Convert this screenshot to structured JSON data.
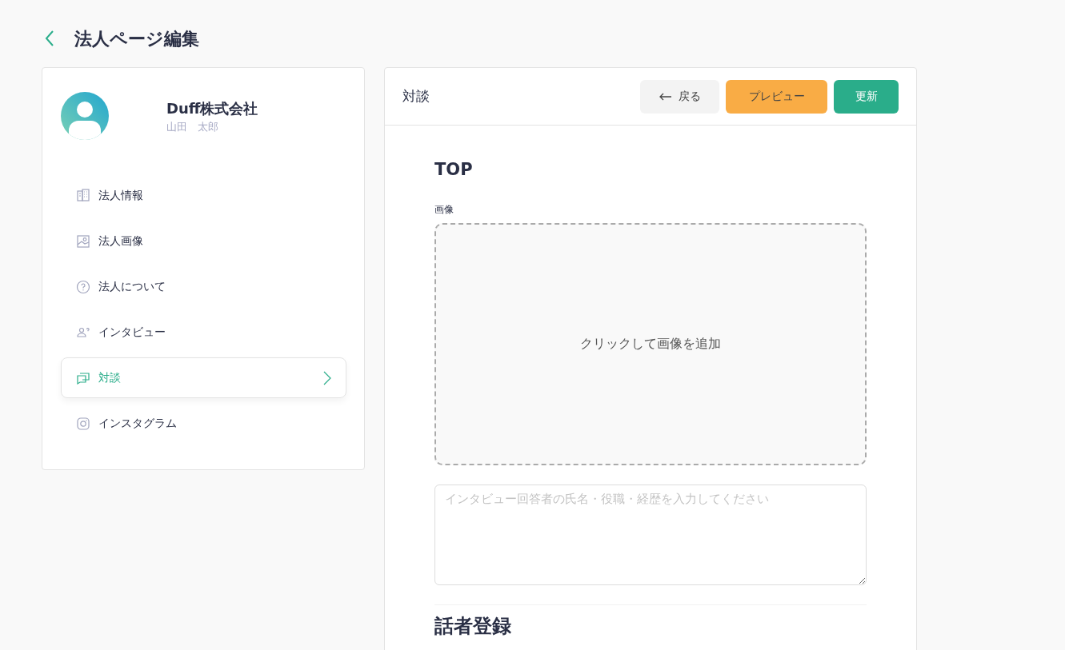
{
  "page_title": "法人ページ編集",
  "profile": {
    "company": "Duff株式会社",
    "person": "山田　太郎"
  },
  "sidebar": {
    "items": [
      {
        "label": "法人情報",
        "kind": "building",
        "selected": false
      },
      {
        "label": "法人画像",
        "kind": "image",
        "selected": false
      },
      {
        "label": "法人について",
        "kind": "question",
        "selected": false
      },
      {
        "label": "インタビュー",
        "kind": "person",
        "selected": false
      },
      {
        "label": "対談",
        "kind": "chat",
        "selected": true
      },
      {
        "label": "インスタグラム",
        "kind": "instagram",
        "selected": false
      }
    ]
  },
  "panel": {
    "title": "対談",
    "buttons": [
      {
        "label": "戻る",
        "kind": "back"
      },
      {
        "label": "プレビュー",
        "kind": "preview"
      },
      {
        "label": "更新",
        "kind": "update"
      }
    ],
    "section_title": "TOP",
    "image_label": "画像",
    "dropzone": "クリックして画像を追加",
    "textarea": {
      "placeholder": "インタビュー回答者の氏名・役職・経歴を入力してください"
    },
    "next_section": "話者登録"
  }
}
